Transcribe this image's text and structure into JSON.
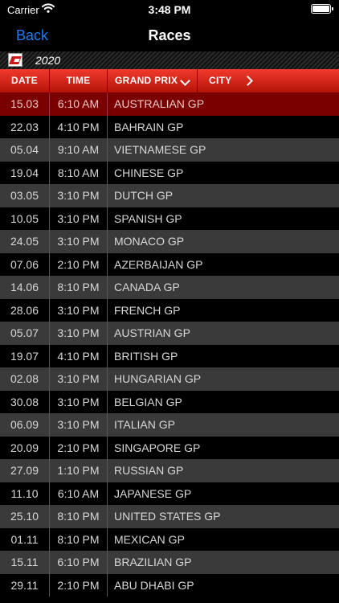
{
  "status": {
    "carrier": "Carrier",
    "time": "3:48 PM"
  },
  "nav": {
    "back_label": "Back",
    "title": "Races"
  },
  "season": {
    "year": "2020",
    "flag_icon": "racing-flag-icon"
  },
  "columns": {
    "date": "DATE",
    "time": "TIME",
    "grand_prix": "GRAND PRIX",
    "city": "CITY"
  },
  "colors": {
    "header_red": "#e02b1e",
    "selected_row": "#7a0000",
    "back_blue": "#1e7cf2"
  },
  "races": [
    {
      "date": "15.03",
      "time": "6:10 AM",
      "gp": "AUSTRALIAN GP",
      "selected": true
    },
    {
      "date": "22.03",
      "time": "4:10 PM",
      "gp": "BAHRAIN GP"
    },
    {
      "date": "05.04",
      "time": "9:10 AM",
      "gp": "VIETNAMESE GP"
    },
    {
      "date": "19.04",
      "time": "8:10 AM",
      "gp": "CHINESE GP"
    },
    {
      "date": "03.05",
      "time": "3:10 PM",
      "gp": "DUTCH GP"
    },
    {
      "date": "10.05",
      "time": "3:10 PM",
      "gp": "SPANISH GP"
    },
    {
      "date": "24.05",
      "time": "3:10 PM",
      "gp": "MONACO GP"
    },
    {
      "date": "07.06",
      "time": "2:10 PM",
      "gp": "AZERBAIJAN GP"
    },
    {
      "date": "14.06",
      "time": "8:10 PM",
      "gp": "CANADA GP"
    },
    {
      "date": "28.06",
      "time": "3:10 PM",
      "gp": "FRENCH GP"
    },
    {
      "date": "05.07",
      "time": "3:10 PM",
      "gp": "AUSTRIAN GP"
    },
    {
      "date": "19.07",
      "time": "4:10 PM",
      "gp": "BRITISH GP"
    },
    {
      "date": "02.08",
      "time": "3:10 PM",
      "gp": "HUNGARIAN GP"
    },
    {
      "date": "30.08",
      "time": "3:10 PM",
      "gp": "BELGIAN GP"
    },
    {
      "date": "06.09",
      "time": "3:10 PM",
      "gp": "ITALIAN GP"
    },
    {
      "date": "20.09",
      "time": "2:10 PM",
      "gp": "SINGAPORE GP"
    },
    {
      "date": "27.09",
      "time": "1:10 PM",
      "gp": "RUSSIAN GP"
    },
    {
      "date": "11.10",
      "time": "6:10 AM",
      "gp": "JAPANESE GP"
    },
    {
      "date": "25.10",
      "time": "8:10 PM",
      "gp": "UNITED STATES GP"
    },
    {
      "date": "01.11",
      "time": "8:10 PM",
      "gp": "MEXICAN GP"
    },
    {
      "date": "15.11",
      "time": "6:10 PM",
      "gp": "BRAZILIAN GP"
    },
    {
      "date": "29.11",
      "time": "2:10 PM",
      "gp": "ABU DHABI GP"
    }
  ]
}
